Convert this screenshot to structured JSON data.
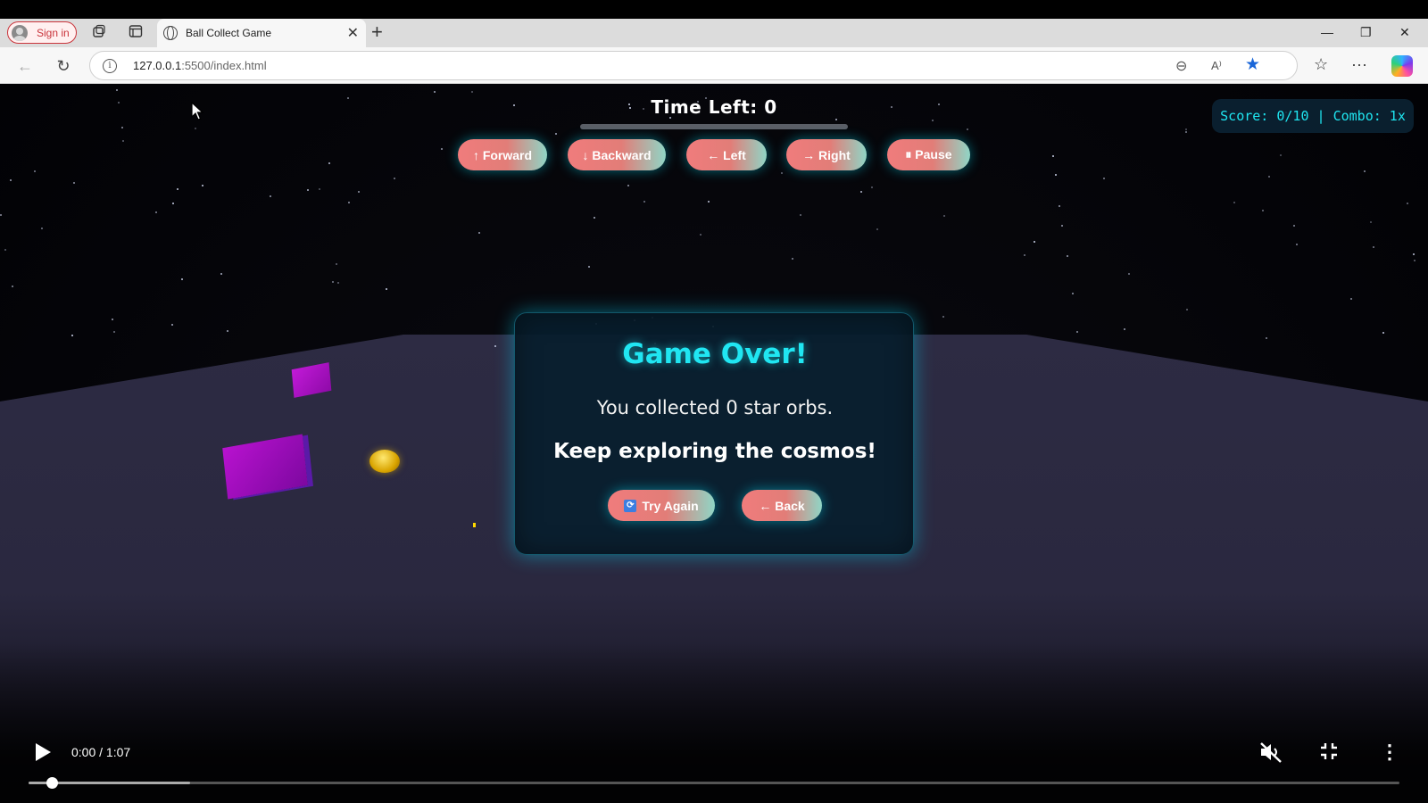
{
  "browser": {
    "signin_label": "Sign in",
    "tab_title": "Ball Collect Game",
    "url_host": "127.0.0.1",
    "url_path": ":5500/index.html"
  },
  "game": {
    "timer_text": "Time Left: 0",
    "time_remaining_fraction": 0,
    "controls": {
      "forward": "↑ Forward",
      "backward": "↓ Backward",
      "left": "← Left",
      "right": "→ Right",
      "pause": "⏸ Pause"
    },
    "score_text": "Score: 0/10 | Combo: 1x",
    "modal": {
      "title": "Game Over!",
      "message": "You collected 0 star orbs.",
      "subtitle": "Keep exploring the cosmos!",
      "try_again": "Try Again",
      "back": "← Back"
    }
  },
  "video": {
    "time": "0:00 / 1:07",
    "progress_fraction": 0,
    "buffered_fraction": 0.118
  },
  "colors": {
    "accent": "#20e6f2",
    "button_gradient_start": "#f07c7c",
    "button_gradient_end": "#8fd6c6",
    "cube": "#b812cf",
    "orb": "#d9a400"
  }
}
